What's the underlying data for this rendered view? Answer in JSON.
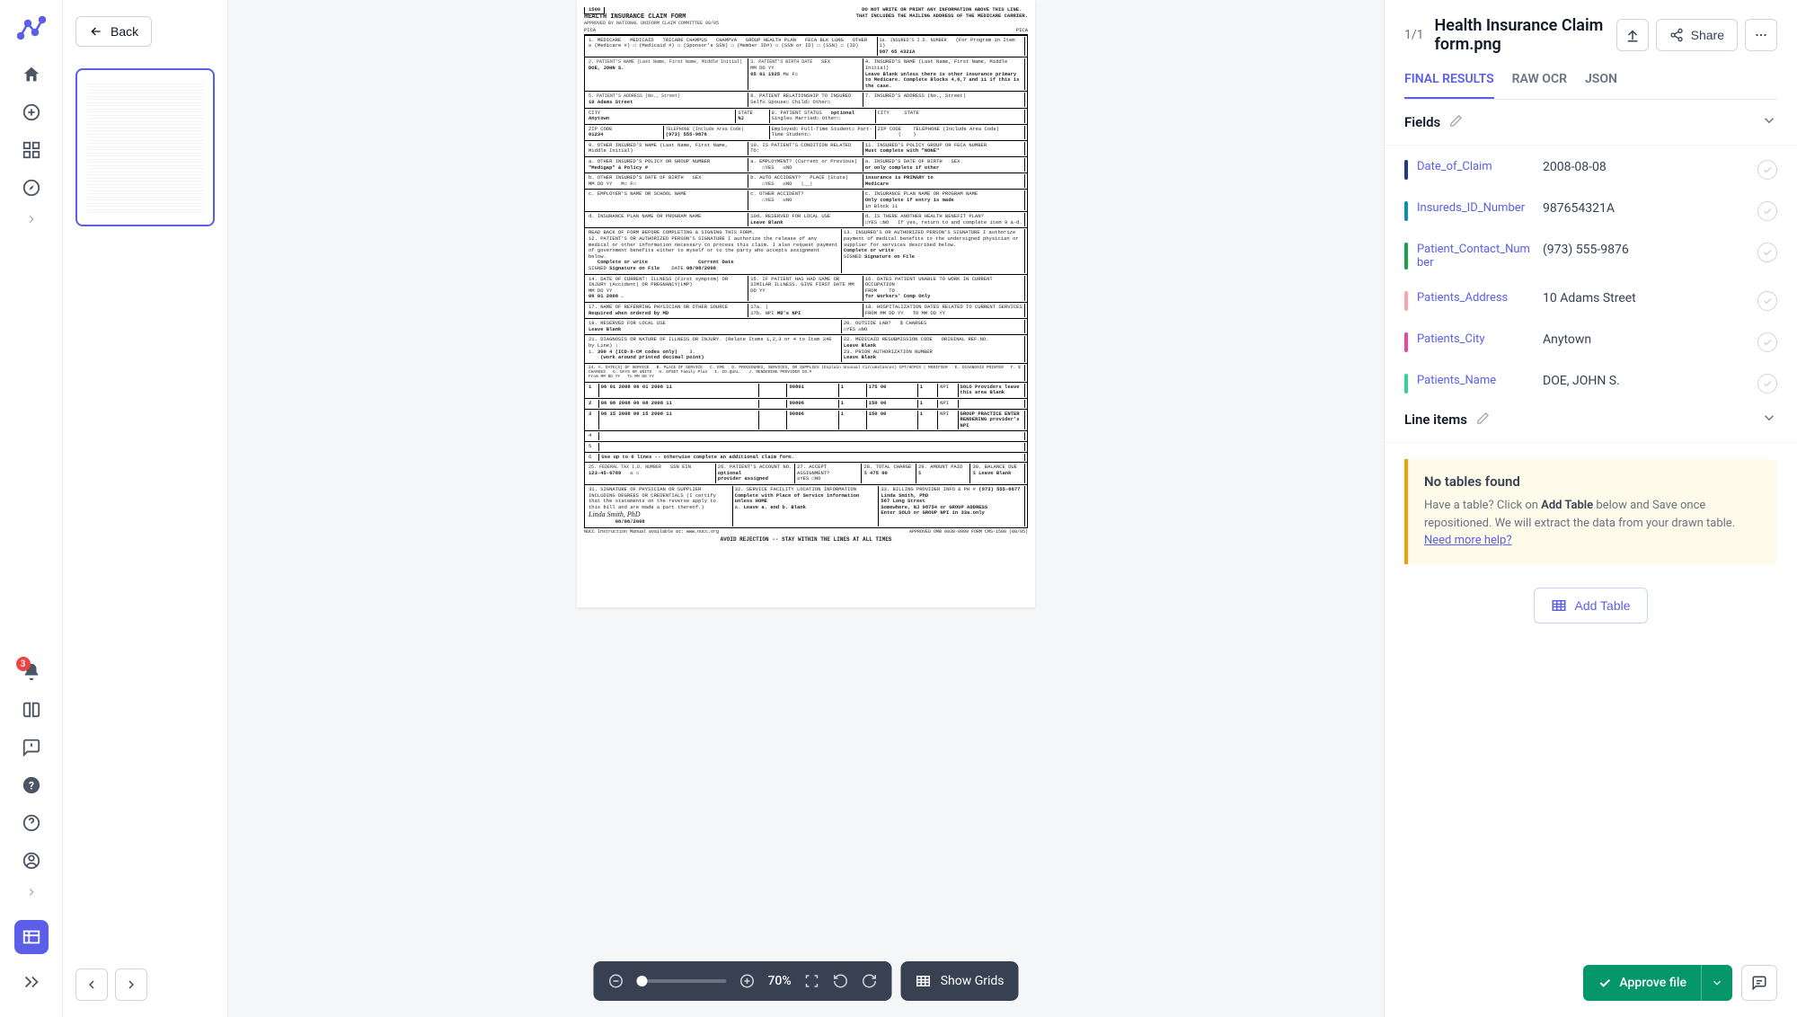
{
  "rail": {
    "notification_count": "3"
  },
  "thumbs": {
    "back_label": "Back"
  },
  "zoom": {
    "percent": "70%",
    "grids_label": "Show Grids"
  },
  "panel": {
    "counter": "1/1",
    "title": "Health Insurance Claim form.png",
    "share_label": "Share",
    "tabs": {
      "final": "FINAL RESULTS",
      "raw": "RAW OCR",
      "json": "JSON"
    },
    "sections": {
      "fields": "Fields",
      "line_items": "Line items"
    },
    "infobox": {
      "title": "No tables found",
      "text_prefix": "Have a table? Click on ",
      "text_bold": "Add Table",
      "text_suffix": " below and Save once repositioned. We will extract the data from your drawn table. ",
      "help_link": "Need more help?"
    },
    "add_table_label": "Add Table",
    "approve_label": "Approve file"
  },
  "fields": [
    {
      "color": "#1e3a8a",
      "label": "Date_of_Claim",
      "value": "2008-08-08"
    },
    {
      "color": "#0891b2",
      "label": "Insureds_ID_Number",
      "value": "987654321A"
    },
    {
      "color": "#16a34a",
      "label": "Patient_Contact_Number",
      "value": "(973) 555-9876"
    },
    {
      "color": "#fda4af",
      "label": "Patients_Address",
      "value": "10 Adams Street"
    },
    {
      "color": "#ec4899",
      "label": "Patients_City",
      "value": "Anytown"
    },
    {
      "color": "#34d399",
      "label": "Patients_Name",
      "value": "DOE, JOHN S."
    },
    {
      "color": "#2563eb",
      "label": "Patients_State",
      "value": "NJ"
    }
  ],
  "form": {
    "title_box": "1500",
    "title": "HEALTH INSURANCE CLAIM FORM",
    "subtitle": "APPROVED BY NATIONAL UNIFORM CLAIM COMMITTEE 08/05",
    "warning1": "DO NOT WRITE OR PRINT ANY INFORMATION ABOVE THIS LINE.",
    "warning2": "THAT INCLUDES THE MAILING ADDRESS OF THE MEDICARE CARRIER.",
    "pica": "PICA",
    "insured_id": "987 65 4321A",
    "insured_id_label": "1a. INSURED'S I.D. NUMBER",
    "patient_name": "DOE, JOHN S.",
    "patient_name_label": "2. PATIENT'S NAME (Last Name, First Name, Middle Initial)",
    "birth": "05  01  1925",
    "birth_label": "3. PATIENT'S BIRTH DATE",
    "address": "10 Adams Street",
    "address_label": "5. PATIENT'S ADDRESS (No., Street)",
    "city": "Anytown",
    "state": "NJ",
    "zip": "01234",
    "phone": "(973) 555-9876",
    "phone_label": "TELEPHONE (Include Area Code)",
    "medigap": "\"Medigap\" & Policy #",
    "sig_on_file": "Signature on File",
    "complete_or_write": "Complete or write",
    "current_date_label": "Current Date",
    "current_date": "08/08/2008",
    "date_illness": "06  01  2008",
    "referring": "Required when ordered by MD",
    "md_npi": "MD's NPI",
    "diag": "300 4 (ICD-9-CM codes only)",
    "diag_note": "(work around printed decimal point)",
    "none": "Must complete with \"NONE\"",
    "only_if": "or only complete if other",
    "primary_to": "insurance is PRIMARY to",
    "medicare": "Medicare",
    "only_complete": "Only complete if entry is made",
    "workers": "for Workers' Comp Only",
    "svc1": "06  01 2008 06  01 2008 11",
    "svc1_code": "90801",
    "svc1_amt": "175 00",
    "svc2": "06  08 2008 06  08 2008 11",
    "svc2_code": "90806",
    "svc2_amt": "150 00",
    "svc3": "06  15 2008 06  15 2008 11",
    "svc3_code": "90806",
    "svc3_amt": "150 00",
    "solo": "SOLO Providers leave this area Blank",
    "group_practice": "GROUP PRACTICE ENTER RENDERING provider's NPI",
    "up_to_6": "Use up to 6 lines -- otherwise complete an additional claim form.",
    "tax_id": "123-45-6789",
    "tax_id_label": "25. FEDERAL TAX I.D. NUMBER",
    "optional": "optional",
    "provider_assigned": "provider assigned",
    "total": "475 00",
    "provider_name": "Linda Smith, PhD",
    "provider_addr": "567 Long Street",
    "provider_city": "Somewhere, NJ 08754 or GROUP ADDRESS",
    "provider_phone": "(973) 555-6677",
    "signature": "Linda Smith, PhD",
    "sign_date": "08/08/2008",
    "complete_place": "Complete with Place of Service information unless HOME",
    "enter_solo": "Enter SOLO or GROUP NPI in 33a.only",
    "leave_ab": "Leave a. and b. Blank",
    "leave_blank": "Leave Blank",
    "must_blank": "Leave Blank unless there is other insurance primary to Medicare. Complete Blocks 4,6,7 and 11 if this is the case.",
    "nucc": "NUCC Instruction Manual available at: www.nucc.org",
    "approved_omb": "APPROVED OMB 0938-0999 FORM CMS-1500 (08/05)",
    "avoid": "AVOID REJECTION -- STAY WITHIN THE LINES AT ALL TIMES",
    "row_1": "1",
    "row_2": "2",
    "row_3": "3",
    "units_1": "1",
    "svc_pipe": " | "
  }
}
